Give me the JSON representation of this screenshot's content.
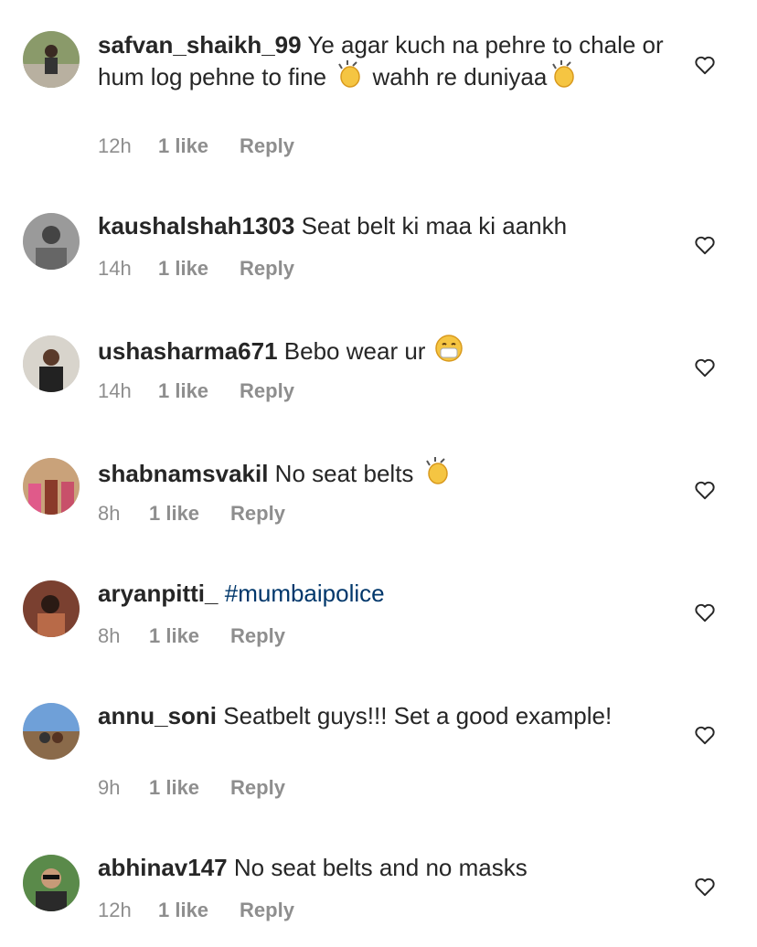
{
  "comments": [
    {
      "username": "safvan_shaikh_99",
      "text_parts": [
        "Ye agar kuch na pehre to chale or hum log pehne to fine ",
        "clap",
        " wahh re duniyaa",
        "clap"
      ],
      "time": "12h",
      "likes": "1 like",
      "reply": "Reply"
    },
    {
      "username": "kaushalshah1303",
      "text_parts": [
        "Seat belt ki maa ki aankh"
      ],
      "time": "14h",
      "likes": "1 like",
      "reply": "Reply"
    },
    {
      "username": "ushasharma671",
      "text_parts": [
        "Bebo wear ur ",
        "mask-face"
      ],
      "time": "14h",
      "likes": "1 like",
      "reply": "Reply"
    },
    {
      "username": "shabnamsvakil",
      "text_parts": [
        "No seat belts ",
        "clap"
      ],
      "time": "8h",
      "likes": "1 like",
      "reply": "Reply"
    },
    {
      "username": "aryanpitti_",
      "text_parts": [],
      "hashtag": "#mumbaipolice",
      "time": "8h",
      "likes": "1 like",
      "reply": "Reply"
    },
    {
      "username": "annu_soni",
      "text_parts": [
        "Seatbelt guys!!! Set a good example!"
      ],
      "time": "9h",
      "likes": "1 like",
      "reply": "Reply"
    },
    {
      "username": "abhinav147",
      "text_parts": [
        "No seat belts and no masks"
      ],
      "time": "12h",
      "likes": "1 like",
      "reply": "Reply"
    }
  ],
  "colors": {
    "hashtag": "#00376b",
    "meta": "#8e8e8e",
    "text": "#262626"
  },
  "icons": {
    "like": "heart-outline-icon",
    "clap": "clapping-hands-emoji",
    "mask": "face-with-medical-mask-emoji"
  }
}
